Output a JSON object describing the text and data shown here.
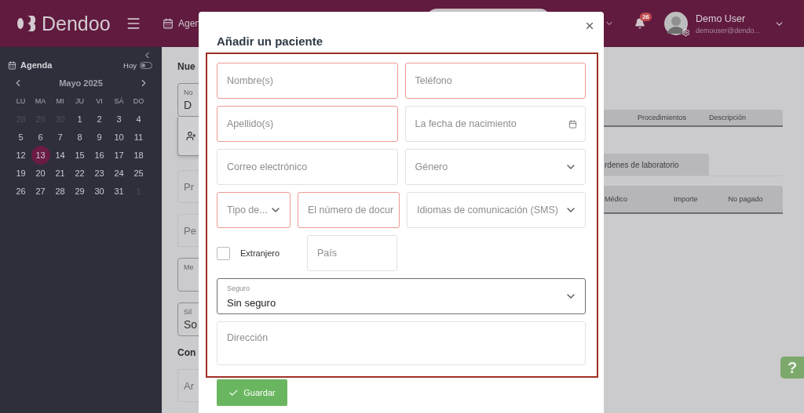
{
  "header": {
    "logo": "Dendoo",
    "nav_item": "Agen",
    "notifications": "26",
    "user": {
      "name": "Demo User",
      "email": "demouser@dendo..."
    }
  },
  "sidebar": {
    "title": "Agenda",
    "today_label": "Hoy",
    "today_on": false,
    "month": "Mayo 2025",
    "weekdays": [
      "LU",
      "MA",
      "MI",
      "JU",
      "VI",
      "SÁ",
      "DO"
    ],
    "weeks": [
      [
        {
          "label": "28",
          "outside": true,
          "selected": false
        },
        {
          "label": "29",
          "outside": true,
          "selected": false
        },
        {
          "label": "30",
          "outside": true,
          "selected": false
        },
        {
          "label": "1",
          "outside": false,
          "selected": false
        },
        {
          "label": "2",
          "outside": false,
          "selected": false
        },
        {
          "label": "3",
          "outside": false,
          "selected": false
        },
        {
          "label": "4",
          "outside": false,
          "selected": false
        }
      ],
      [
        {
          "label": "5",
          "outside": false,
          "selected": false
        },
        {
          "label": "6",
          "outside": false,
          "selected": false
        },
        {
          "label": "7",
          "outside": false,
          "selected": false
        },
        {
          "label": "8",
          "outside": false,
          "selected": false
        },
        {
          "label": "9",
          "outside": false,
          "selected": false
        },
        {
          "label": "10",
          "outside": false,
          "selected": false
        },
        {
          "label": "11",
          "outside": false,
          "selected": false
        }
      ],
      [
        {
          "label": "12",
          "outside": false,
          "selected": false
        },
        {
          "label": "13",
          "outside": false,
          "selected": true
        },
        {
          "label": "14",
          "outside": false,
          "selected": false
        },
        {
          "label": "15",
          "outside": false,
          "selected": false
        },
        {
          "label": "16",
          "outside": false,
          "selected": false
        },
        {
          "label": "17",
          "outside": false,
          "selected": false
        },
        {
          "label": "18",
          "outside": false,
          "selected": false
        }
      ],
      [
        {
          "label": "19",
          "outside": false,
          "selected": false
        },
        {
          "label": "20",
          "outside": false,
          "selected": false
        },
        {
          "label": "21",
          "outside": false,
          "selected": false
        },
        {
          "label": "22",
          "outside": false,
          "selected": false
        },
        {
          "label": "23",
          "outside": false,
          "selected": false
        },
        {
          "label": "24",
          "outside": false,
          "selected": false
        },
        {
          "label": "25",
          "outside": false,
          "selected": false
        }
      ],
      [
        {
          "label": "26",
          "outside": false,
          "selected": false
        },
        {
          "label": "27",
          "outside": false,
          "selected": false
        },
        {
          "label": "28",
          "outside": false,
          "selected": false
        },
        {
          "label": "29",
          "outside": false,
          "selected": false
        },
        {
          "label": "30",
          "outside": false,
          "selected": false
        },
        {
          "label": "31",
          "outside": false,
          "selected": false
        },
        {
          "label": "1",
          "outside": true,
          "selected": false
        }
      ]
    ]
  },
  "background": {
    "left": [
      {
        "kind": "title",
        "text": "Nue"
      },
      {
        "kind": "filled",
        "label": "No",
        "value": "D"
      },
      {
        "kind": "action"
      },
      {
        "kind": "empty",
        "text": "Pr"
      },
      {
        "kind": "empty",
        "text": "Pe"
      },
      {
        "kind": "labeled",
        "label": "Me"
      },
      {
        "kind": "filled",
        "label": "Sil",
        "value": "So"
      },
      {
        "kind": "title",
        "text": "Con"
      },
      {
        "kind": "empty",
        "text": "Ar"
      }
    ],
    "table_1": {
      "columns": [
        "Procedimientos",
        "Descripción"
      ]
    },
    "tab": {
      "label": "rdenes de laboratorio"
    },
    "table_2": {
      "columns": [
        "Médico",
        "Importe",
        "No pagado"
      ]
    }
  },
  "help": "?",
  "modal": {
    "title": "Añadir un paciente",
    "rows": [
      [
        {
          "kind": "input",
          "placeholder": "Nombre(s)",
          "invalid": true
        },
        {
          "kind": "input",
          "placeholder": "Teléfono",
          "invalid": true
        }
      ],
      [
        {
          "kind": "input",
          "placeholder": "Apellido(s)",
          "invalid": true
        },
        {
          "kind": "date",
          "placeholder": "La fecha de nacimiento",
          "invalid": false
        }
      ],
      [
        {
          "kind": "input",
          "placeholder": "Correo electrónico",
          "invalid": false
        },
        {
          "kind": "select",
          "placeholder": "Género",
          "invalid": false
        }
      ],
      [
        {
          "kind": "select",
          "placeholder": "Tipo de...",
          "invalid": true
        },
        {
          "kind": "input",
          "placeholder": "El número de docur",
          "invalid": true
        },
        {
          "kind": "select",
          "placeholder": "Idiomas de comunicación (SMS)",
          "invalid": false
        }
      ],
      [
        {
          "kind": "checkbox",
          "label": "Extranjero",
          "checked": false
        },
        {
          "kind": "input",
          "placeholder": "País",
          "invalid": false
        }
      ],
      [
        {
          "kind": "select",
          "label": "Seguro",
          "value": "Sin seguro",
          "invalid": false
        }
      ],
      [
        {
          "kind": "textarea",
          "placeholder": "Dirección",
          "invalid": false
        }
      ]
    ],
    "submit": "Guardar"
  }
}
